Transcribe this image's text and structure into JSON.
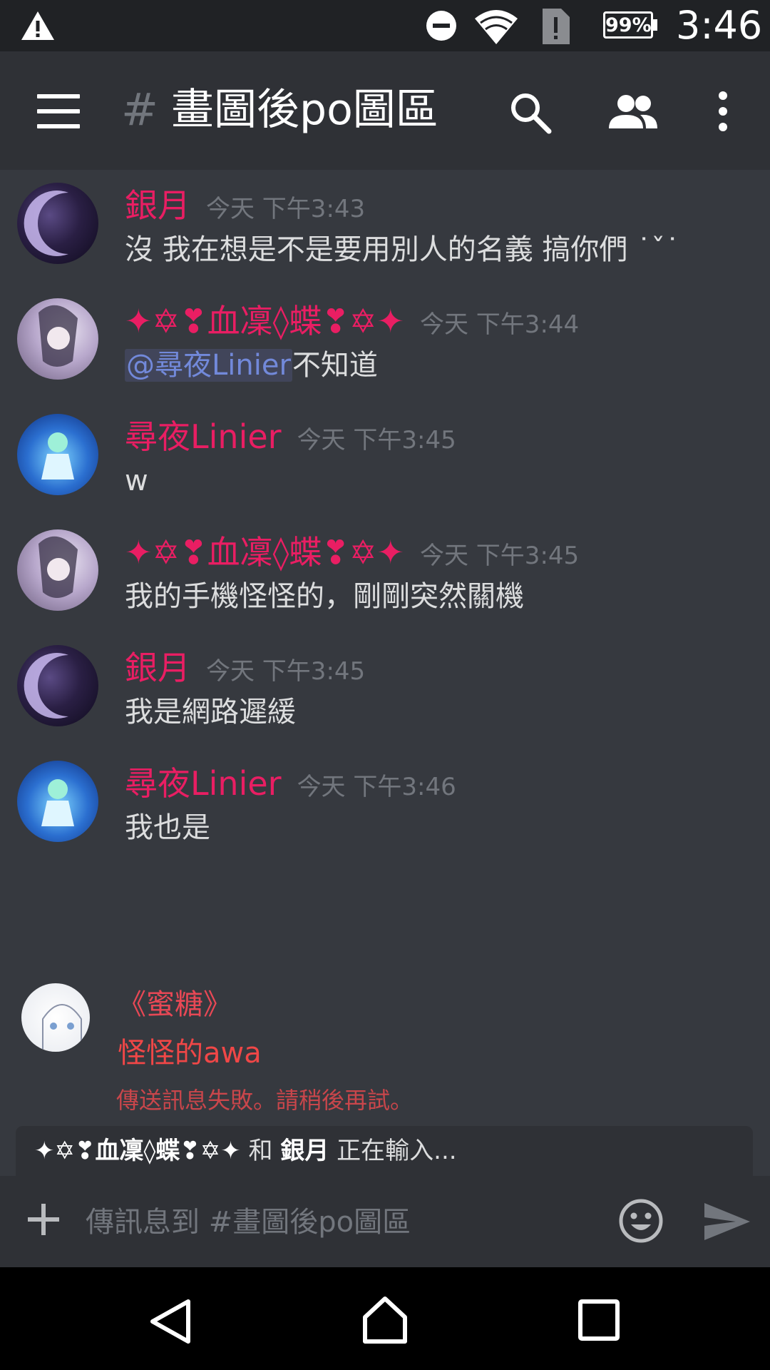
{
  "status_bar": {
    "battery": "99%",
    "time": "3:46",
    "icons": [
      "warning-icon",
      "do-not-disturb-icon",
      "wifi-icon",
      "sim-alert-icon",
      "battery-icon"
    ]
  },
  "header": {
    "hash": "#",
    "channel_name": "畫圖後po圖區",
    "icons": [
      "menu-icon",
      "search-icon",
      "members-icon",
      "more-vert-icon"
    ]
  },
  "messages": [
    {
      "author": "銀月",
      "time": "今天 下午3:43",
      "text": "沒 我在想是不是要用別人的名義 搞你們 ˙ˇ˙",
      "avatar": "crescent-moon"
    },
    {
      "author": "✦✡❣血凜◊蝶❣✡✦",
      "time": "今天 下午3:44",
      "mention": "@尋夜Linier",
      "text": "不知道",
      "avatar": "anime-girl-lavender"
    },
    {
      "author": "尋夜Linier",
      "time": "今天 下午3:45",
      "text": "w",
      "avatar": "anime-girl-blue"
    },
    {
      "author": "✦✡❣血凜◊蝶❣✡✦",
      "time": "今天 下午3:45",
      "text": "我的手機怪怪的，剛剛突然關機",
      "avatar": "anime-girl-lavender"
    },
    {
      "author": "銀月",
      "time": "今天 下午3:45",
      "text": "我是網路遲緩",
      "avatar": "crescent-moon"
    },
    {
      "author": "尋夜Linier",
      "time": "今天 下午3:46",
      "text": "我也是",
      "avatar": "anime-girl-blue"
    }
  ],
  "failed_message": {
    "author": "《蜜糖》",
    "text": "怪怪的awa",
    "error": "傳送訊息失敗。請稍後再試。",
    "avatar": "sketch-girl"
  },
  "typing": {
    "user1": "✦✡❣血凜◊蝶❣✡✦",
    "joiner": " 和 ",
    "user2": "銀月",
    "suffix": " 正在輸入..."
  },
  "composer": {
    "placeholder": "傳訊息到 #畫圖後po圖區",
    "icons": [
      "add-icon",
      "emoji-icon",
      "send-icon"
    ]
  },
  "navbar": {
    "icons": [
      "back-icon",
      "home-icon",
      "recents-icon"
    ]
  },
  "colors": {
    "background": "#36393f",
    "header": "#2f3136",
    "status_bar": "#202225",
    "author_pink": "#e91e63",
    "mention_blue": "#7289da",
    "error_red": "#f04747"
  }
}
